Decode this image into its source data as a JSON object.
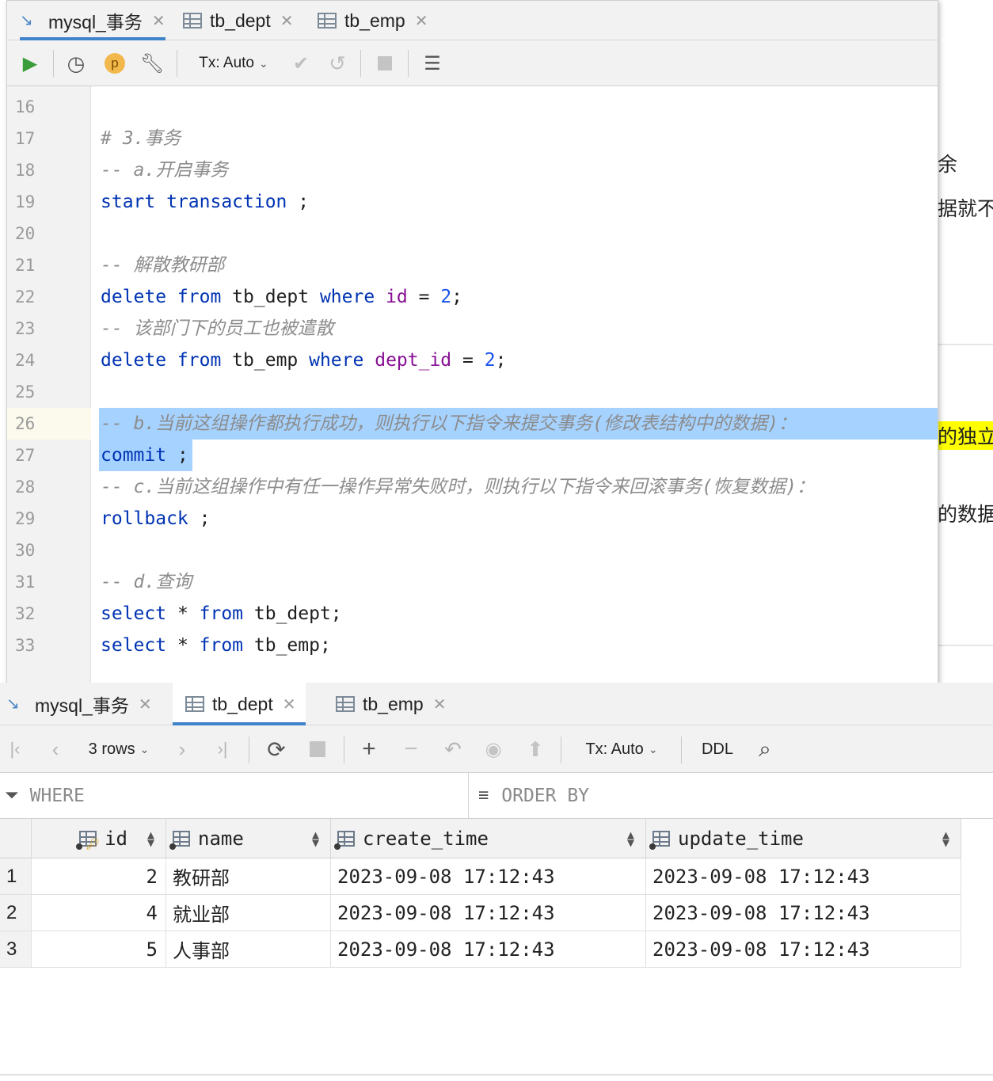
{
  "background_fragments": {
    "frag1": "余",
    "frag2": "据就不",
    "frag3": "的独立",
    "frag4": "的数据"
  },
  "editor": {
    "tabs": [
      {
        "label": "mysql_事务",
        "icon": "mysql-console-icon",
        "active": true
      },
      {
        "label": "tb_dept",
        "icon": "table-icon",
        "active": false
      },
      {
        "label": "tb_emp",
        "icon": "table-icon",
        "active": false
      }
    ],
    "toolbar": {
      "tx_label": "Tx: Auto",
      "p_badge": "p"
    },
    "lines": [
      {
        "n": "16"
      },
      {
        "n": "17"
      },
      {
        "n": "18"
      },
      {
        "n": "19"
      },
      {
        "n": "20"
      },
      {
        "n": "21"
      },
      {
        "n": "22"
      },
      {
        "n": "23"
      },
      {
        "n": "24"
      },
      {
        "n": "25"
      },
      {
        "n": "26"
      },
      {
        "n": "27"
      },
      {
        "n": "28"
      },
      {
        "n": "29"
      },
      {
        "n": "30"
      },
      {
        "n": "31"
      },
      {
        "n": "32"
      },
      {
        "n": "33"
      }
    ],
    "code": {
      "l17": "# 3.事务",
      "l18": "-- a.开启事务",
      "l19_kw": "start transaction",
      "l19_rest": " ;",
      "l21": "-- 解散教研部",
      "l22_a": "delete from",
      "l22_b": " tb_dept ",
      "l22_c": "where",
      "l22_d": " ",
      "l22_e": "id",
      "l22_f": " = ",
      "l22_g": "2",
      "l22_h": ";",
      "l23": "-- 该部门下的员工也被遣散",
      "l24_a": "delete from",
      "l24_b": " tb_emp ",
      "l24_c": "where",
      "l24_d": " ",
      "l24_e": "dept_id",
      "l24_f": " = ",
      "l24_g": "2",
      "l24_h": ";",
      "l26": "-- b.当前这组操作都执行成功，则执行以下指令来提交事务(修改表结构中的数据)：",
      "l27_kw": "commit",
      "l27_rest": " ;",
      "l28": "-- c.当前这组操作中有任一操作异常失败时，则执行以下指令来回滚事务(恢复数据)：",
      "l29_kw": "rollback",
      "l29_rest": " ;",
      "l31": "-- d.查询",
      "l32_a": "select",
      "l32_b": " * ",
      "l32_c": "from",
      "l32_d": " tb_dept;",
      "l33_a": "select",
      "l33_b": " * ",
      "l33_c": "from",
      "l33_d": " tb_emp;"
    }
  },
  "results": {
    "tabs": [
      {
        "label": "mysql_事务",
        "icon": "mysql-console-icon",
        "active": false
      },
      {
        "label": "tb_dept",
        "icon": "table-icon",
        "active": true
      },
      {
        "label": "tb_emp",
        "icon": "table-icon",
        "active": false
      }
    ],
    "toolbar": {
      "rows_label": "3 rows",
      "tx_label": "Tx: Auto",
      "ddl_label": "DDL"
    },
    "where_label": "WHERE",
    "orderby_label": "ORDER BY",
    "columns": [
      "id",
      "name",
      "create_time",
      "update_time"
    ],
    "rows": [
      {
        "num": "1",
        "id": "2",
        "name": "教研部",
        "create_time": "2023-09-08 17:12:43",
        "update_time": "2023-09-08 17:12:43"
      },
      {
        "num": "2",
        "id": "4",
        "name": "就业部",
        "create_time": "2023-09-08 17:12:43",
        "update_time": "2023-09-08 17:12:43"
      },
      {
        "num": "3",
        "id": "5",
        "name": "人事部",
        "create_time": "2023-09-08 17:12:43",
        "update_time": "2023-09-08 17:12:43"
      }
    ]
  },
  "colors": {
    "keyword": "#0033b3",
    "column": "#871094",
    "number": "#1750eb",
    "comment": "#8c8c8c",
    "selection": "#a6d2ff",
    "tab_underline": "#4083c9",
    "run_green": "#3a9c3a"
  }
}
